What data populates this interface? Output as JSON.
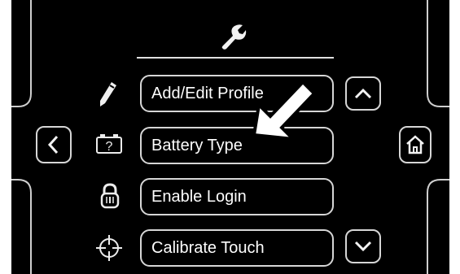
{
  "header": {
    "icon": "wrench-icon"
  },
  "menu": {
    "items": [
      {
        "label": "Add/Edit Profile",
        "icon": "pencil-icon"
      },
      {
        "label": "Battery Type",
        "icon": "battery-question-icon"
      },
      {
        "label": "Enable Login",
        "icon": "lock-icon"
      },
      {
        "label": "Calibrate Touch",
        "icon": "crosshair-icon"
      }
    ]
  },
  "navigation": {
    "back": "chevron-left-icon",
    "home": "home-icon",
    "scroll_up": "chevron-up-icon",
    "scroll_down": "chevron-down-icon"
  },
  "annotation": {
    "pointer": "arrow-pointer",
    "target": "Battery Type"
  },
  "colors": {
    "background": "#000000",
    "outline": "#d6d6d6",
    "text": "#ffffff"
  }
}
